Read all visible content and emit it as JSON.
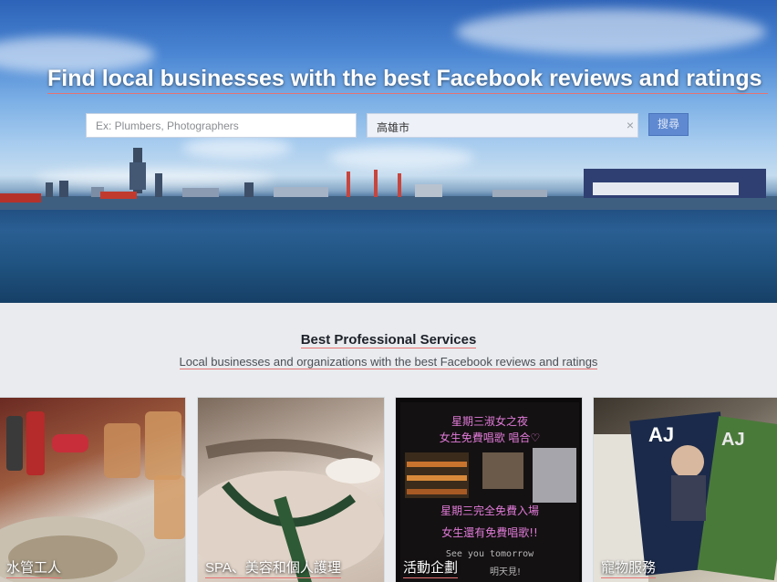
{
  "hero": {
    "title": "Find local businesses with the best Facebook reviews and ratings",
    "search_what_placeholder": "Ex: Plumbers, Photographers",
    "search_where_value": "高雄市",
    "clear_icon": "×",
    "search_button": "搜尋"
  },
  "section": {
    "title": "Best Professional Services",
    "subtitle": "Local businesses and organizations with the best Facebook reviews and ratings"
  },
  "cards": [
    {
      "label": "水管工人"
    },
    {
      "label": "SPA、美容和個人護理"
    },
    {
      "label": "活動企劃",
      "poster_lines": [
        "星期三淑女之夜",
        "女生免費唱歌 唱合♡",
        "星期三完全免費入場",
        "女生還有免費唱歌!!",
        "See you tomorrow",
        "明天見!"
      ]
    },
    {
      "label": "寵物服務",
      "magazine_text": "AJ"
    }
  ],
  "colors": {
    "accent_underline": "#e57373",
    "search_button": "#5f8ad1",
    "page_bg": "#e9ebee"
  }
}
